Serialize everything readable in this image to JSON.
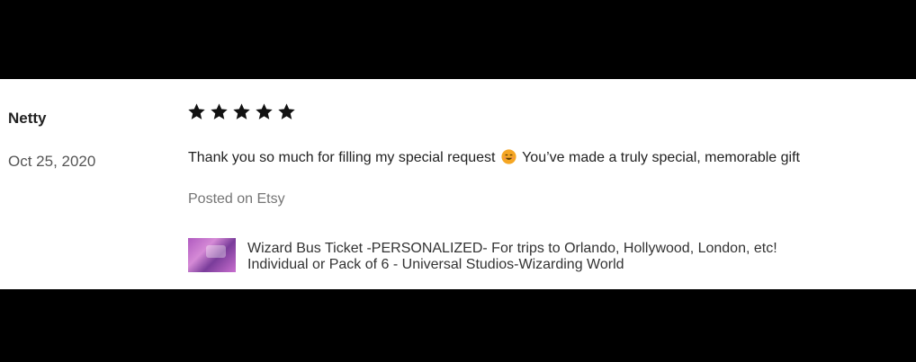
{
  "review": {
    "reviewer_name": "Netty",
    "date": "Oct 25, 2020",
    "rating": 5,
    "max_rating": 5,
    "text_before_emoji": "Thank you so much for filling my special request",
    "emoji": "smiling-face-emoji",
    "text_after_emoji": "You’ve made a truly special, memorable gift",
    "posted_on": "Posted on Etsy"
  },
  "item": {
    "title_line1": "Wizard Bus Ticket -PERSONALIZED- For trips to Orlando, Hollywood, London, etc!",
    "title_line2": "Individual or Pack of 6 - Universal Studios-Wizarding World",
    "thumbnail_icon": "item-thumbnail-image"
  },
  "colors": {
    "background_frame": "#000000",
    "card": "#ffffff",
    "star": "#111111",
    "posted_on": "#757575"
  }
}
